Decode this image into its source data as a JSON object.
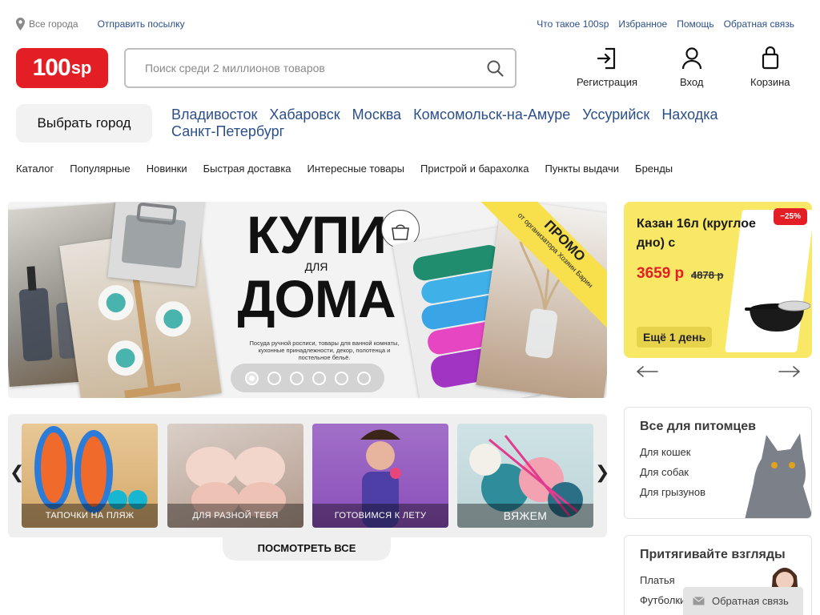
{
  "topbar": {
    "city": "Все города",
    "send": "Отправить посылку",
    "links": [
      "Что такое 100sp",
      "Избранное",
      "Помощь",
      "Обратная связь"
    ]
  },
  "logo": {
    "main": "100",
    "suffix": "sp",
    "color": "#e31e24"
  },
  "search": {
    "placeholder": "Поиск среди 2 миллионов товаров",
    "value": ""
  },
  "header_actions": {
    "register": "Регистрация",
    "login": "Вход",
    "cart": "Корзина"
  },
  "choose_city": "Выбрать город",
  "cities": [
    "Владивосток",
    "Хабаровск",
    "Москва",
    "Комсомольск-на-Амуре",
    "Уссурийск",
    "Находка",
    "Санкт-Петербург"
  ],
  "nav": [
    "Каталог",
    "Популярные",
    "Новинки",
    "Быстрая доставка",
    "Интересные товары",
    "Пристрой и барахолка",
    "Пункты выдачи",
    "Бренды"
  ],
  "banner": {
    "title_top": "КУПИ",
    "title_mid": "ДЛЯ",
    "title_bottom": "ДОМА",
    "description": "Посуда ручной росписи, товары для ванной комнаты, кухонные принадлежности, декор, полотенца и постельное бельё.",
    "promo": "ПРОМО",
    "promo_sub": "от организатора Хозяин Барин",
    "logo_text": "Хозяин Барин",
    "slides": 6,
    "active_slide": 1
  },
  "deal": {
    "name": "Казан 16л (круглое дно) с",
    "price": "3659 р",
    "old_price": "4878 р",
    "discount": "−25%",
    "days_left": "Ещё 1 день"
  },
  "categories": {
    "items": [
      "Тапочки на пляж",
      "Для разной тебя",
      "Готовимся к лету",
      "Вяжем"
    ],
    "see_all": "ПОСМОТРЕТЬ ВСЕ"
  },
  "pets": {
    "title": "Все для питомцев",
    "items": [
      "Для кошек",
      "Для собак",
      "Для грызунов"
    ]
  },
  "looks": {
    "title": "Притягивайте взгляды",
    "items": [
      "Платья",
      "Футболки"
    ]
  },
  "feedback_button": "Обратная связь",
  "colors": {
    "brand_red": "#e31e24",
    "link_blue": "#2c4f8a",
    "deal_yellow": "#f9e866",
    "promo_yellow": "#f7e04b"
  }
}
